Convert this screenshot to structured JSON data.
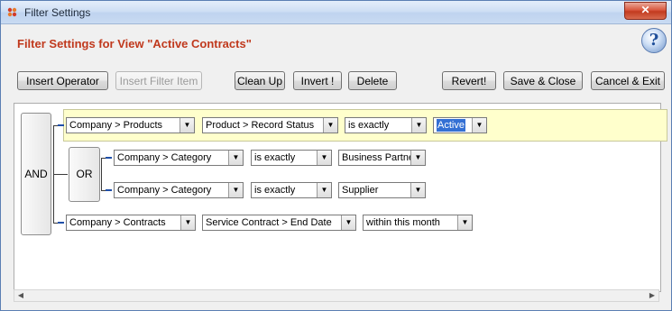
{
  "window": {
    "title": "Filter Settings"
  },
  "header": {
    "title": "Filter Settings for View \"Active Contracts\""
  },
  "toolbar": {
    "insert_operator": "Insert Operator",
    "insert_filter_item": "Insert Filter Item",
    "clean_up": "Clean Up",
    "invert": "Invert !",
    "delete": "Delete",
    "revert": "Revert!",
    "save_close": "Save & Close",
    "cancel_exit": "Cancel & Exit"
  },
  "operators": {
    "and": "AND",
    "or": "OR"
  },
  "rows": [
    {
      "field": "Company > Products",
      "attribute": "Product > Record Status",
      "condition": "is exactly",
      "value": "Active"
    },
    {
      "field": "Company > Category",
      "condition": "is exactly",
      "value": "Business Partner"
    },
    {
      "field": "Company > Category",
      "condition": "is exactly",
      "value": "Supplier"
    },
    {
      "field": "Company > Contracts",
      "attribute": "Service Contract > End Date",
      "condition": "within this month"
    }
  ],
  "colors": {
    "title_accent": "#c0391d",
    "highlight_row": "#ffffcc",
    "connector": "#1f4fa8",
    "selected_value": "#3470d4"
  },
  "icons": {
    "app": "filter-app-icon",
    "help": "help-question-icon",
    "close": "close-icon",
    "dropdown": "dropdown-arrow-icon"
  }
}
